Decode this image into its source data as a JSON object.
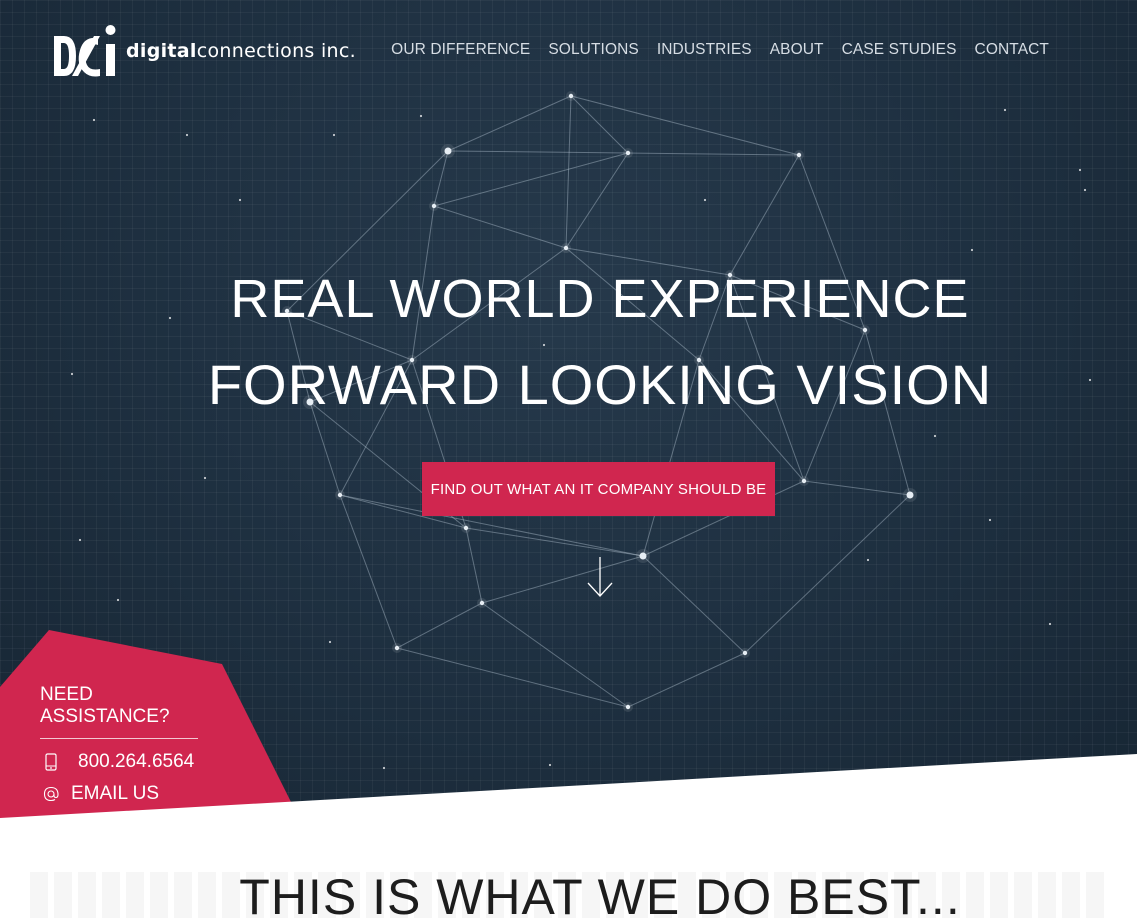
{
  "brand": {
    "name_bold": "digital",
    "name_light": "connections inc.",
    "accent_color": "#d0264f",
    "hero_bg": "#1f3142"
  },
  "nav": {
    "items": [
      "OUR DIFFERENCE",
      "SOLUTIONS",
      "INDUSTRIES",
      "ABOUT",
      "CASE STUDIES",
      "CONTACT"
    ]
  },
  "hero": {
    "line1": "REAL WORLD EXPERIENCE",
    "line2": "FORWARD LOOKING VISION",
    "cta_label": "FIND OUT WHAT AN IT COMPANY SHOULD BE",
    "scroll_icon": "arrow-down-icon"
  },
  "assistance": {
    "title": "NEED ASSISTANCE?",
    "phone": "800.264.6564",
    "phone_icon": "mobile-phone-icon",
    "email_label": "EMAIL US",
    "email_icon": "at-sign-icon"
  },
  "section": {
    "title": "THIS IS WHAT WE DO BEST..."
  }
}
